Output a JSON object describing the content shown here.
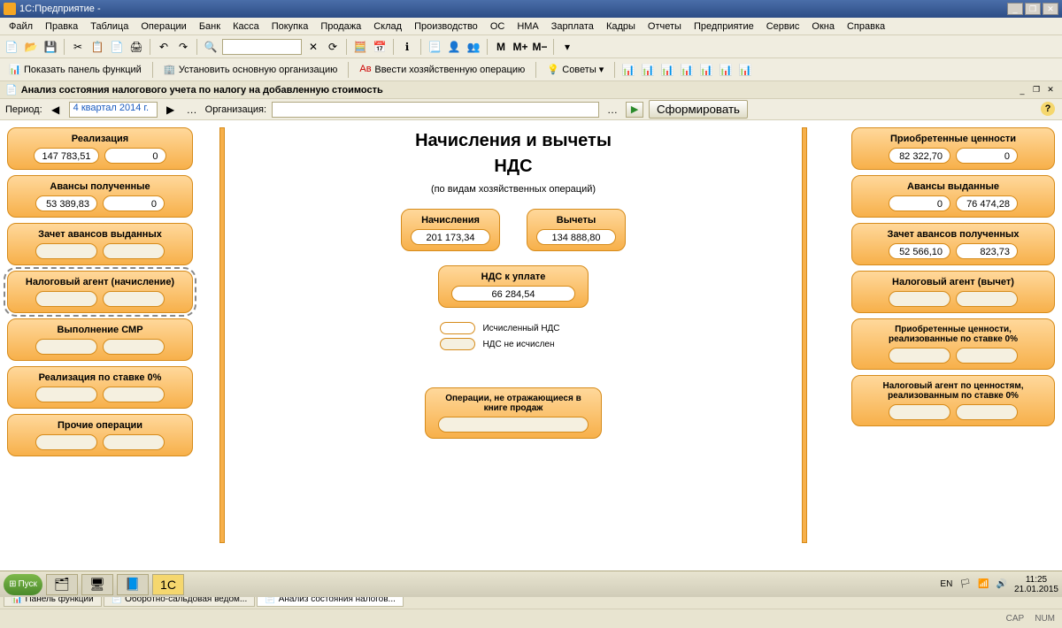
{
  "window": {
    "title": "1С:Предприятие -"
  },
  "menu": [
    "Файл",
    "Правка",
    "Таблица",
    "Операции",
    "Банк",
    "Касса",
    "Покупка",
    "Продажа",
    "Склад",
    "Производство",
    "ОС",
    "НМА",
    "Зарплата",
    "Кадры",
    "Отчеты",
    "Предприятие",
    "Сервис",
    "Окна",
    "Справка"
  ],
  "toolbar2": {
    "b1": "Показать панель функций",
    "b2": "Установить основную организацию",
    "b3": "Ввести хозяйственную операцию",
    "b4": "Советы"
  },
  "doc": {
    "title": "Анализ состояния налогового учета по налогу на добавленную стоимость"
  },
  "params": {
    "period_label": "Период:",
    "period_value": "4 квартал 2014 г.",
    "org_label": "Организация:",
    "org_value": "",
    "form_btn": "Сформировать"
  },
  "center": {
    "title1": "Начисления и вычеты",
    "title2": "НДС",
    "subtitle": "(по видам хозяйственных операций)",
    "nachisleniya_label": "Начисления",
    "nachisleniya_value": "201 173,34",
    "vychety_label": "Вычеты",
    "vychety_value": "134 888,80",
    "nds_label": "НДС к уплате",
    "nds_value": "66 284,54",
    "legend1": "Исчисленный НДС",
    "legend2": "НДС не исчислен",
    "ops_label": "Операции, не отражающиеся в книге продаж"
  },
  "left": [
    {
      "title": "Реализация",
      "v1": "147 783,51",
      "v2": "0"
    },
    {
      "title": "Авансы полученные",
      "v1": "53 389,83",
      "v2": "0"
    },
    {
      "title": "Зачет авансов выданных",
      "v1": "",
      "v2": ""
    },
    {
      "title": "Налоговый агент (начисление)",
      "v1": "",
      "v2": ""
    },
    {
      "title": "Выполнение СМР",
      "v1": "",
      "v2": ""
    },
    {
      "title": "Реализация по ставке 0%",
      "v1": "",
      "v2": ""
    },
    {
      "title": "Прочие операции",
      "v1": "",
      "v2": ""
    }
  ],
  "right": [
    {
      "title": "Приобретенные ценности",
      "v1": "82 322,70",
      "v2": "0"
    },
    {
      "title": "Авансы выданные",
      "v1": "0",
      "v2": "76 474,28"
    },
    {
      "title": "Зачет авансов полученных",
      "v1": "52 566,10",
      "v2": "823,73"
    },
    {
      "title": "Налоговый агент (вычет)",
      "v1": "",
      "v2": ""
    },
    {
      "title": "Приобретенные ценности, реализованные по ставке 0%",
      "v1": "",
      "v2": ""
    },
    {
      "title": "Налоговый агент по ценностям, реализованным по ставке 0%",
      "v1": "",
      "v2": ""
    }
  ],
  "tabs": {
    "t1": "Панель функций",
    "t2": "Оборотно-сальдовая ведом...",
    "t3": "Анализ состояния налогов..."
  },
  "status": {
    "cap": "CAP",
    "num": "NUM"
  },
  "taskbar": {
    "start": "Пуск",
    "lang": "EN",
    "time": "11:25",
    "date": "21.01.2015"
  }
}
